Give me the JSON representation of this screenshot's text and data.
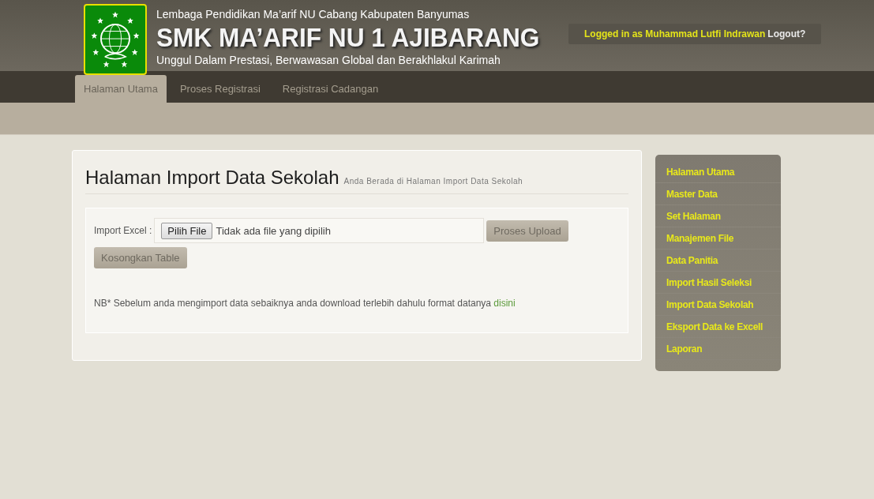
{
  "header": {
    "org": "Lembaga Pendidikan Ma’arif NU Cabang Kabupaten Banyumas",
    "school": "SMK MA’ARIF NU 1 AJIBARANG",
    "motto": "Unggul Dalam Prestasi, Berwawasan Global dan Berakhlakul Karimah",
    "login_text": "Logged in as Muhammad Lutfi Indrawan",
    "logout": "Logout?"
  },
  "nav": [
    {
      "label": "Halaman Utama",
      "selected": true
    },
    {
      "label": "Proses Registrasi",
      "selected": false
    },
    {
      "label": "Registrasi Cadangan",
      "selected": false
    }
  ],
  "page": {
    "title": "Halaman Import Data Sekolah",
    "subtitle": "Anda Berada di Halaman Import Data Sekolah",
    "import_label": "Import Excel :",
    "file_button": "Pilih File",
    "file_status": "Tidak ada file yang dipilih",
    "upload_button": "Proses Upload",
    "clear_button": "Kosongkan Table",
    "note": "NB* Sebelum anda mengimport data sebaiknya anda download terlebih dahulu format datanya",
    "note_link": "disini"
  },
  "sidebar": {
    "items": [
      "Halaman Utama",
      "Master Data",
      "Set Halaman",
      "Manajemen File",
      "Data Panitia",
      "Import Hasil Seleksi",
      "Import Data Sekolah",
      "Eksport Data ke Excell",
      "Laporan"
    ]
  }
}
